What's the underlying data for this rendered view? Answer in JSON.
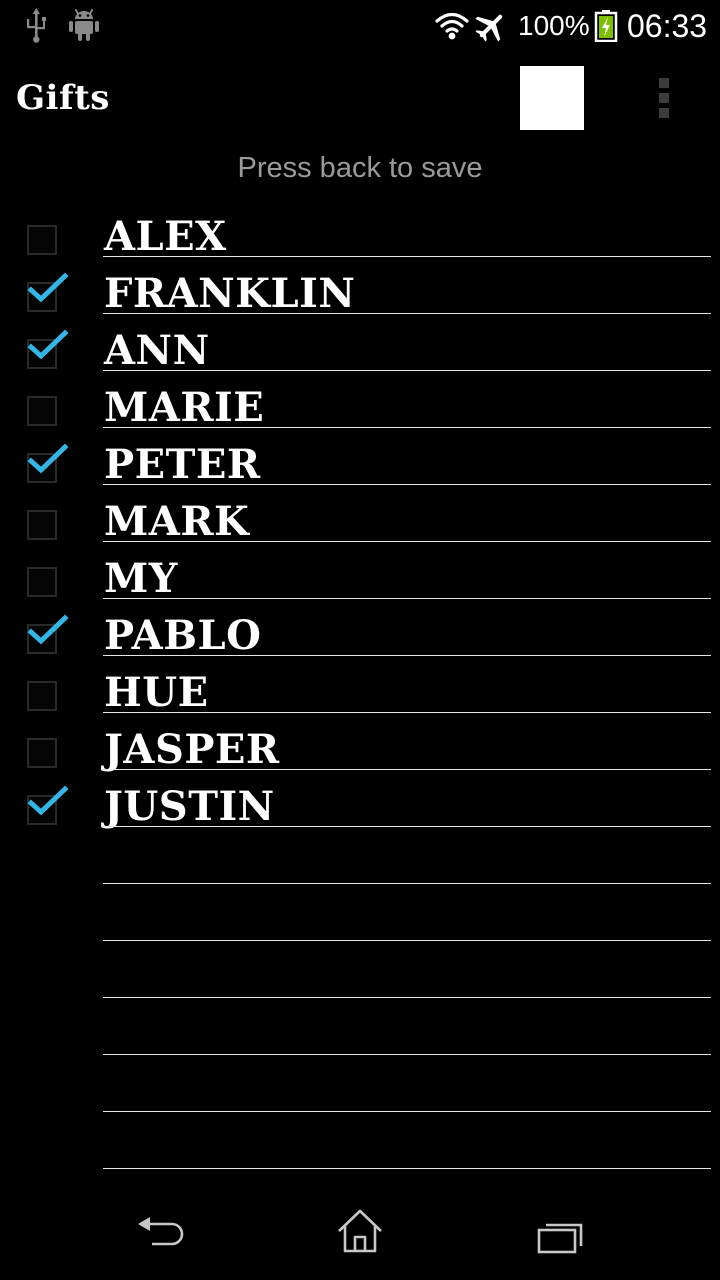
{
  "status_bar": {
    "icons_left": [
      "usb-icon",
      "android-icon"
    ],
    "icons_right": [
      "wifi-icon",
      "airplane-icon",
      "battery-charging-icon"
    ],
    "battery_percent": "100%",
    "time": "06:33"
  },
  "action_bar": {
    "title": "Gifts",
    "action_icon": "white-square",
    "overflow_icon": "overflow-menu-icon"
  },
  "hint": "Press back to save",
  "colors": {
    "check_accent": "#33b5e5",
    "background": "#000000",
    "hint_text": "#9a9a9a"
  },
  "rows": [
    {
      "name": "Alex",
      "checked": false
    },
    {
      "name": "Franklin",
      "checked": true
    },
    {
      "name": "Ann",
      "checked": true
    },
    {
      "name": "Marie",
      "checked": false
    },
    {
      "name": "Peter",
      "checked": true
    },
    {
      "name": "Mark",
      "checked": false
    },
    {
      "name": "My",
      "checked": false
    },
    {
      "name": "Pablo",
      "checked": true
    },
    {
      "name": "Hue",
      "checked": false
    },
    {
      "name": "Jasper",
      "checked": false
    },
    {
      "name": "Justin",
      "checked": true
    },
    {
      "name": "",
      "checked": null
    },
    {
      "name": "",
      "checked": null
    },
    {
      "name": "",
      "checked": null
    },
    {
      "name": "",
      "checked": null
    },
    {
      "name": "",
      "checked": null
    },
    {
      "name": "",
      "checked": null
    }
  ],
  "nav_bar": {
    "icons": [
      "back-icon",
      "home-icon",
      "recents-icon"
    ]
  }
}
